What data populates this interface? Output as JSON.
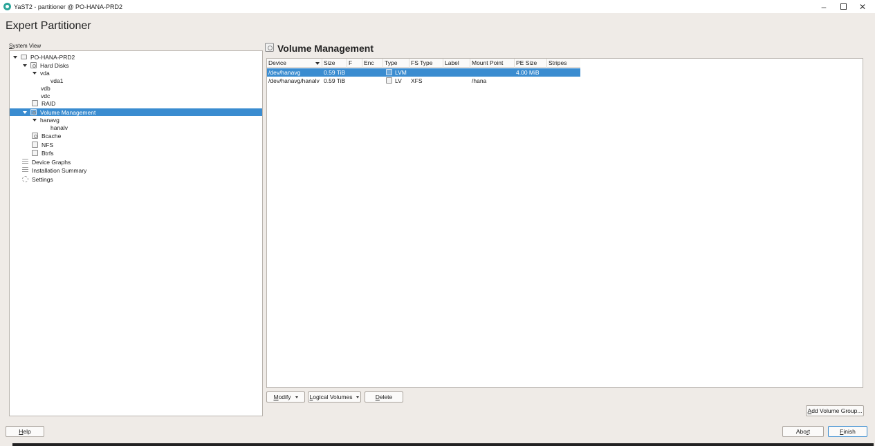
{
  "window": {
    "title": "YaST2 - partitioner @ PO-HANA-PRD2",
    "minimize": "–",
    "close": "✕"
  },
  "app_title": "Expert Partitioner",
  "system_view": {
    "label_first": "S",
    "label_rest": "ystem View",
    "items": [
      {
        "label": "PO-HANA-PRD2",
        "icon": "computer-icon"
      },
      {
        "label": "Hard Disks",
        "icon": "hard-disk-icon"
      },
      {
        "label": "vda"
      },
      {
        "label": "vda1"
      },
      {
        "label": "vdb"
      },
      {
        "label": "vdc"
      },
      {
        "label": "RAID",
        "icon": "raid-icon"
      },
      {
        "label": "Volume Management",
        "icon": "volume-management-icon"
      },
      {
        "label": "hanavg"
      },
      {
        "label": "hanalv"
      },
      {
        "label": "Bcache",
        "icon": "bcache-icon"
      },
      {
        "label": "NFS",
        "icon": "nfs-icon"
      },
      {
        "label": "Btrfs",
        "icon": "btrfs-icon"
      },
      {
        "label": "Device Graphs",
        "icon": "device-graphs-icon"
      },
      {
        "label": "Installation Summary",
        "icon": "installation-summary-icon"
      },
      {
        "label": "Settings",
        "icon": "settings-icon"
      }
    ]
  },
  "main": {
    "title": "Volume Management",
    "columns": [
      "Device",
      "Size",
      "F",
      "Enc",
      "Type",
      "FS Type",
      "Label",
      "Mount Point",
      "PE Size",
      "Stripes"
    ],
    "rows": [
      {
        "device": "/dev/hanavg",
        "size": "0.59 TiB",
        "f": "",
        "enc": "",
        "type": "LVM",
        "fs_type": "",
        "label": "",
        "mount_point": "",
        "pe_size": "4.00 MiB",
        "stripes": ""
      },
      {
        "device": "/dev/hanavg/hanalv",
        "size": "0.59 TiB",
        "f": "",
        "enc": "",
        "type": "LV",
        "fs_type": "XFS",
        "label": "",
        "mount_point": "/hana",
        "pe_size": "",
        "stripes": ""
      }
    ]
  },
  "buttons": {
    "modify": {
      "first": "M",
      "rest": "odify"
    },
    "logical_volumes": {
      "first": "L",
      "rest": "ogical Volumes"
    },
    "delete": {
      "first": "D",
      "rest": "elete"
    },
    "add_volume_group": {
      "first": "A",
      "rest": "dd Volume Group..."
    },
    "help": {
      "first": "H",
      "rest": "elp"
    },
    "abort": {
      "pre": "Abo",
      "under": "r",
      "post": "t"
    },
    "finish": {
      "first": "F",
      "rest": "inish"
    }
  }
}
